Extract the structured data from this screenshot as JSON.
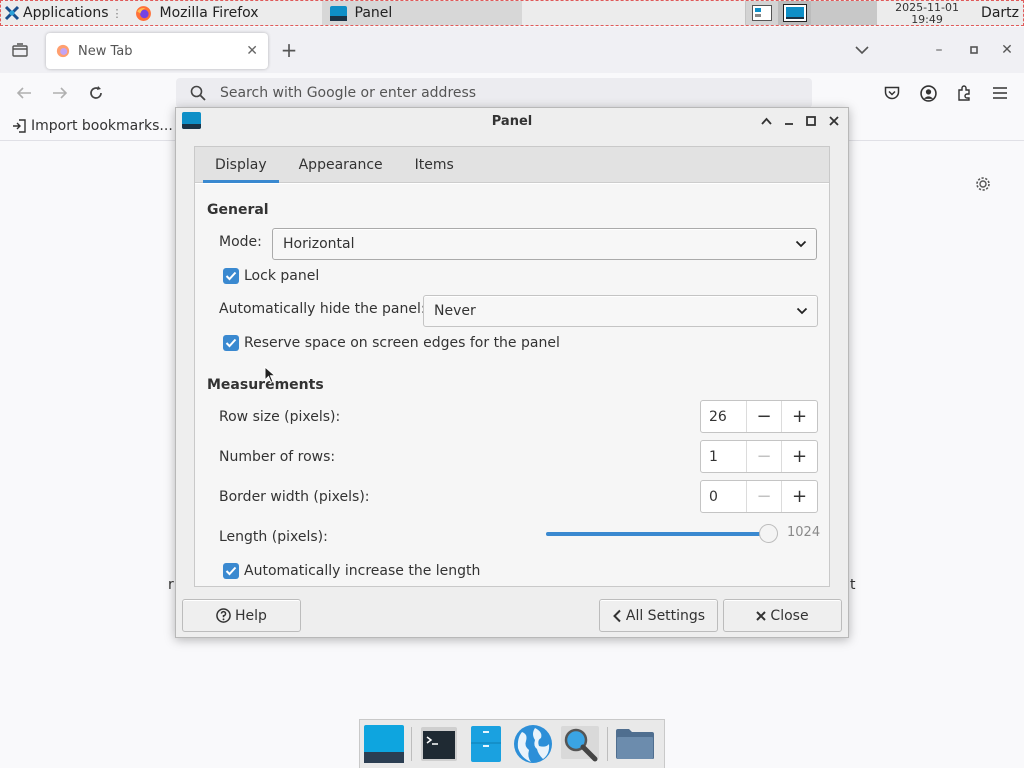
{
  "top_panel": {
    "applications_label": "Applications",
    "tasks": [
      {
        "label": "Mozilla Firefox",
        "icon": "firefox-icon"
      },
      {
        "label": "Panel",
        "icon": "panel-icon"
      }
    ],
    "clock_date": "2025-11-01",
    "clock_time": "19:49",
    "user": "Dartz"
  },
  "browser": {
    "tab_title": "New Tab",
    "url_placeholder": "Search with Google or enter address",
    "bookmark_import": "Import bookmarks...",
    "new_tab_symbol": "+"
  },
  "dialog": {
    "title": "Panel",
    "tabs": [
      "Display",
      "Appearance",
      "Items"
    ],
    "active_tab": "Display",
    "general": {
      "heading": "General",
      "mode_label": "Mode:",
      "mode_value": "Horizontal",
      "lock_panel_label": "Lock panel",
      "lock_panel_checked": true,
      "autohide_label": "Automatically hide the panel:",
      "autohide_value": "Never",
      "reserve_space_label": "Reserve space on screen edges for the panel",
      "reserve_space_checked": true
    },
    "measurements": {
      "heading": "Measurements",
      "row_size_label": "Row size (pixels):",
      "row_size_value": "26",
      "rows_label": "Number of rows:",
      "rows_value": "1",
      "border_label": "Border width (pixels):",
      "border_value": "0",
      "length_label": "Length (pixels):",
      "length_value": "1024",
      "length_fraction": 1.0,
      "auto_length_label": "Automatically increase the length",
      "auto_length_checked": true
    },
    "buttons": {
      "help": "Help",
      "all_settings": "All Settings",
      "close": "Close"
    }
  },
  "dock": {
    "items": [
      "show-desktop-icon",
      "terminal-icon",
      "file-manager-icon",
      "web-browser-icon",
      "app-finder-icon",
      "folder-icon"
    ]
  },
  "colors": {
    "accent": "#3a89d0",
    "dialog_bg": "#eeeeee",
    "panel_bg": "#ececec"
  }
}
